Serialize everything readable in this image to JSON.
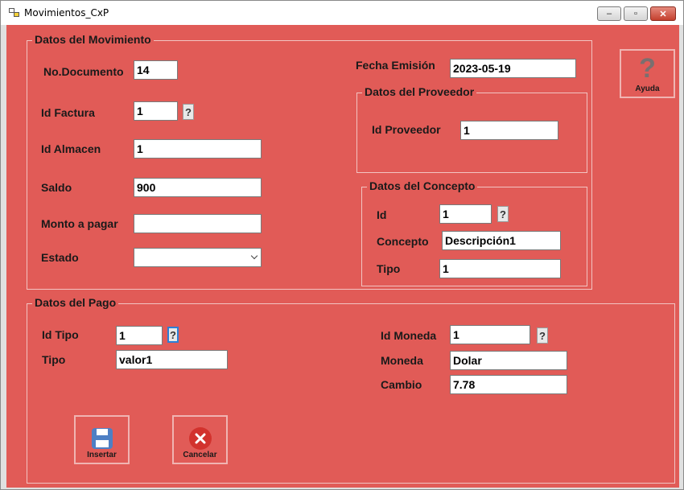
{
  "window": {
    "title": "Movimientos_CxP",
    "minimize": "–",
    "restore": "▫",
    "close": "✕"
  },
  "movimiento": {
    "legend": "Datos del Movimiento",
    "no_documento": {
      "label": "No.Documento",
      "value": "14"
    },
    "fecha_emision": {
      "label": "Fecha Emisión",
      "value": "2023-05-19"
    },
    "id_factura": {
      "label": "Id Factura",
      "value": "1"
    },
    "id_almacen": {
      "label": "Id Almacen",
      "value": "1"
    },
    "saldo": {
      "label": "Saldo",
      "value": "900"
    },
    "monto_pagar": {
      "label": "Monto a pagar",
      "value": ""
    },
    "estado": {
      "label": "Estado",
      "value": ""
    }
  },
  "proveedor": {
    "legend": "Datos del Proveedor",
    "id_proveedor": {
      "label": "Id  Proveedor",
      "value": "1"
    }
  },
  "concepto": {
    "legend": "Datos del Concepto",
    "id": {
      "label": "Id",
      "value": "1"
    },
    "concepto": {
      "label": "Concepto",
      "value": "Descripción1"
    },
    "tipo": {
      "label": "Tipo",
      "value": "1"
    }
  },
  "pago": {
    "legend": "Datos del Pago",
    "id_tipo": {
      "label": "Id Tipo",
      "value": "1"
    },
    "tipo": {
      "label": "Tipo",
      "value": "valor1"
    },
    "id_moneda": {
      "label": "Id Moneda",
      "value": "1"
    },
    "moneda": {
      "label": "Moneda",
      "value": "Dolar"
    },
    "cambio": {
      "label": "Cambio",
      "value": "7.78"
    }
  },
  "buttons": {
    "help_glyph": "?",
    "ayuda": "Ayuda",
    "insertar": "Insertar",
    "cancelar": "Cancelar",
    "lookup": "?"
  },
  "colors": {
    "form_background": "#e15b57",
    "group_border": "#f2c4c2",
    "save_icon": "#4e7fc4",
    "cancel_icon": "#d2322d"
  },
  "icons": [
    "app-icon",
    "help-icon",
    "save-icon",
    "cancel-icon"
  ]
}
